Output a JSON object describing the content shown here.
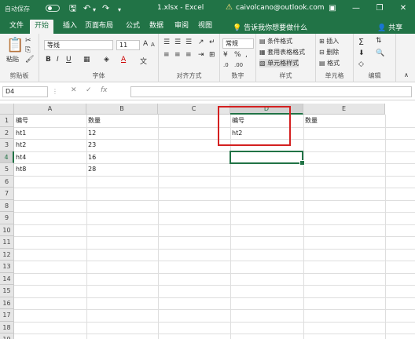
{
  "titlebar": {
    "autosave": "自动保存",
    "filename": "1.xlsx - Excel",
    "account": "caivolcano@outlook.com"
  },
  "tabs": [
    "文件",
    "开始",
    "插入",
    "页面布局",
    "公式",
    "数据",
    "审阅",
    "视图"
  ],
  "tell_me": "告诉我你想要做什么",
  "share": "共享",
  "ribbon": {
    "paste": "粘贴",
    "font_name": "等线",
    "font_size": "11",
    "number_format": "常规",
    "cond_format": "条件格式",
    "table_format": "套用表格格式",
    "cell_styles": "单元格样式",
    "insert": "插入",
    "delete": "删除",
    "format": "格式",
    "groups": {
      "clipboard": "剪贴板",
      "font": "字体",
      "alignment": "对齐方式",
      "number": "数字",
      "styles": "样式",
      "cells": "单元格",
      "editing": "编辑"
    }
  },
  "namebox": "D4",
  "columns": [
    "A",
    "B",
    "C",
    "D",
    "E"
  ],
  "rows": [
    "1",
    "2",
    "3",
    "4",
    "5",
    "6",
    "7",
    "8",
    "9",
    "10",
    "11",
    "12",
    "13",
    "14",
    "15",
    "16",
    "17",
    "18",
    "19"
  ],
  "cells": {
    "A1": "编号",
    "B1": "数量",
    "D1": "编号",
    "E1": "数量",
    "A2": "ht1",
    "B2": "12",
    "D2": "ht2",
    "A3": "ht2",
    "B3": "23",
    "A4": "ht4",
    "B4": "16",
    "A5": "ht8",
    "B5": "28"
  },
  "colors": {
    "excel_green": "#217346",
    "highlight_red": "#d42020"
  }
}
